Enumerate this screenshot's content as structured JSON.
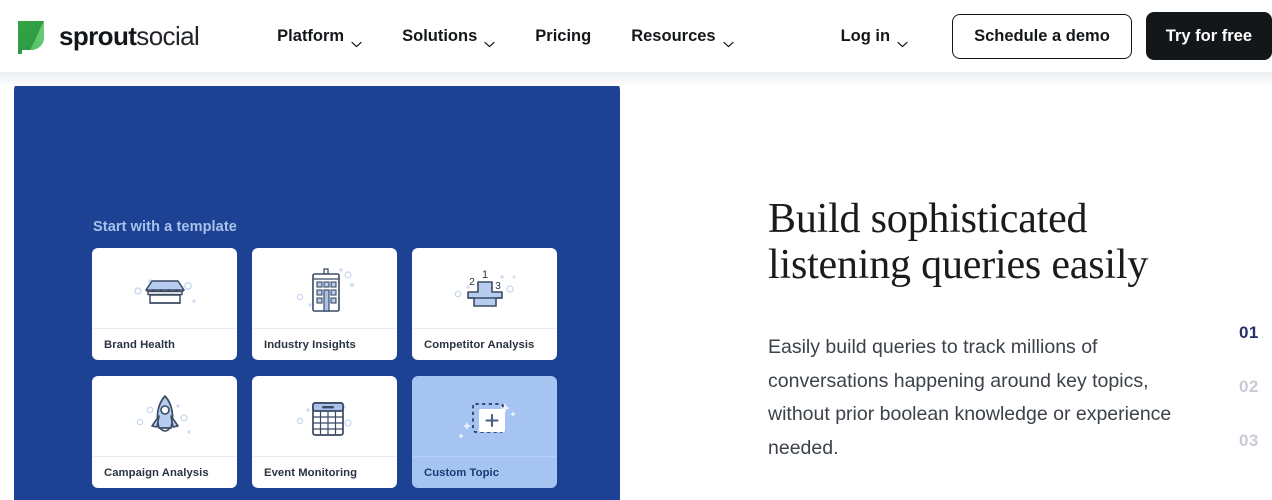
{
  "header": {
    "logo": {
      "icon": "sprout-leaf-icon",
      "name_bold": "sprout",
      "name_light": "social"
    },
    "nav": [
      {
        "label": "Platform",
        "has_chevron": true,
        "icon": "chevron-down-icon"
      },
      {
        "label": "Solutions",
        "has_chevron": true,
        "icon": "chevron-down-icon"
      },
      {
        "label": "Pricing",
        "has_chevron": false,
        "icon": ""
      },
      {
        "label": "Resources",
        "has_chevron": true,
        "icon": "chevron-down-icon"
      }
    ],
    "login": {
      "label": "Log in",
      "icon": "chevron-down-icon"
    },
    "demo_button": "Schedule a demo",
    "try_button": "Try for free"
  },
  "panel": {
    "title": "Start with a template",
    "background_color": "#1d4294",
    "cards": [
      {
        "label": "Brand Health",
        "icon": "storefront-icon",
        "selected": false
      },
      {
        "label": "Industry Insights",
        "icon": "building-icon",
        "selected": false
      },
      {
        "label": "Competitor Analysis",
        "icon": "podium-icon",
        "selected": false
      },
      {
        "label": "Campaign Analysis",
        "icon": "rocket-icon",
        "selected": false
      },
      {
        "label": "Event Monitoring",
        "icon": "calendar-icon",
        "selected": false
      },
      {
        "label": "Custom Topic",
        "icon": "add-dashed-box-icon",
        "selected": true
      }
    ],
    "podium_numbers": {
      "first": "1",
      "second": "2",
      "third": "3"
    }
  },
  "content": {
    "headline_line1": "Build sophisticated",
    "headline_line2": "listening queries easily",
    "body": "Easily build queries to track millions of conversations happening around key topics, without prior boolean knowledge or experience needed."
  },
  "stepper": {
    "steps": [
      {
        "label": "01",
        "active": true
      },
      {
        "label": "02",
        "active": false
      },
      {
        "label": "03",
        "active": false
      }
    ],
    "active_color": "#26306b",
    "inactive_color": "#c9ccd6"
  }
}
